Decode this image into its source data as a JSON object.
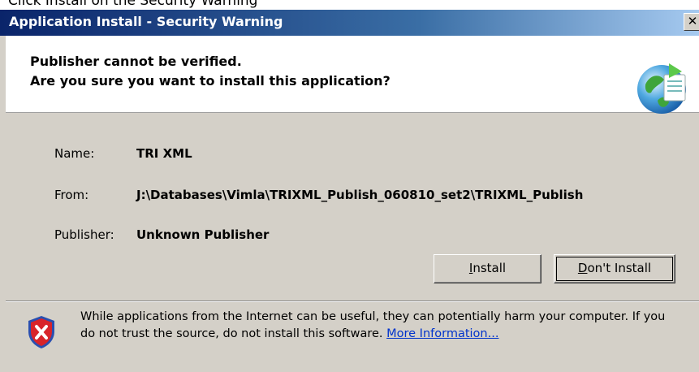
{
  "caption": "Click Install on the Security Warning",
  "window": {
    "title": "Application Install - Security Warning",
    "close_glyph": "✕"
  },
  "header": {
    "line1": "Publisher cannot be verified.",
    "line2": "Are you sure you want to install this application?",
    "icon": "globe-document-icon"
  },
  "fields": {
    "name_label": "Name:",
    "name_value": "TRI XML",
    "from_label": "From:",
    "from_value": "J:\\Databases\\Vimla\\TRIXML_Publish_060810_set2\\TRIXML_Publish",
    "publisher_label": "Publisher:",
    "publisher_value": "Unknown Publisher"
  },
  "buttons": {
    "install_mnemonic": "I",
    "install_rest": "nstall",
    "dont_install_mnemonic": "D",
    "dont_install_rest": "on't Install"
  },
  "warning": {
    "icon": "security-shield-icon",
    "text": "While applications from the Internet can be useful, they can potentially harm your computer. If you do not trust the source, do not install this software.",
    "link": "More Information..."
  },
  "colors": {
    "titlebar_start": "#0a246a",
    "titlebar_end": "#a6caf0",
    "dialog_bg": "#d4d0c8",
    "link": "#0033cc"
  }
}
